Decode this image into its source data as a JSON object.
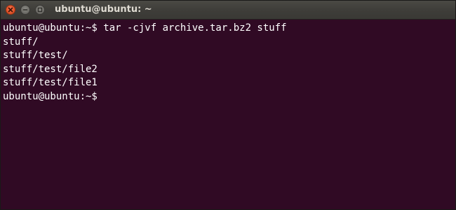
{
  "window": {
    "title": "ubuntu@ubuntu: ~",
    "controls": {
      "close": "close-icon",
      "minimize": "minimize-icon",
      "maximize": "maximize-icon"
    },
    "colors": {
      "terminal_background": "#300a24",
      "text": "#ffffff",
      "close_button": "#e4572e",
      "titlebar": "#3e3d39"
    }
  },
  "terminal": {
    "lines": [
      "ubuntu@ubuntu:~$ tar -cjvf archive.tar.bz2 stuff",
      "stuff/",
      "stuff/test/",
      "stuff/test/file2",
      "stuff/test/file1",
      "ubuntu@ubuntu:~$"
    ]
  }
}
